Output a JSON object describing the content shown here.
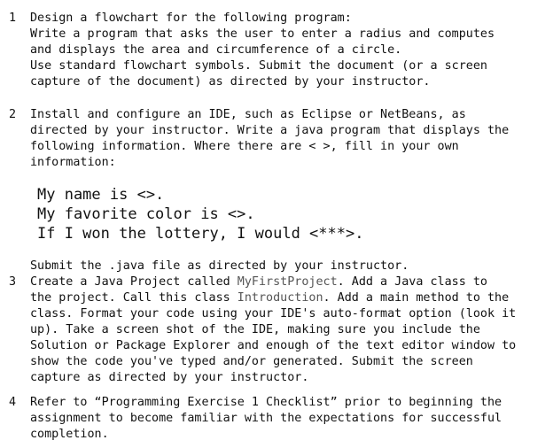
{
  "items": [
    {
      "number": "1",
      "lines": [
        "Design a flowchart for the following program:",
        "Write a program that asks the user to enter a radius and computes",
        "and displays the area and circumference of a circle.",
        "Use standard flowchart symbols. Submit the document (or a screen",
        "capture of the document) as directed by your instructor."
      ]
    },
    {
      "number": "2",
      "lines": [
        "Install and configure an IDE, such as Eclipse or NetBeans, as",
        "directed by your instructor. Write a java program that displays the",
        "following information. Where there are < >, fill in your own",
        "information:"
      ],
      "example_lines": [
        "My name is <>.",
        "My favorite color is <>.",
        "If I won the lottery, I would <***>."
      ],
      "after": "Submit the .java file as directed by your instructor."
    },
    {
      "number": "3",
      "line1_before": "Create a Java Project called ",
      "project_name": "MyFirstProject",
      "line1_after": ". Add a Java class to",
      "line2_before": "the project. Call this class ",
      "class_name": "Introduction",
      "line2_after": ". Add a main method to the",
      "lines": [
        "class. Format your code using your IDE's auto-format option (look it",
        "up). Take a screen shot of the IDE, making sure you include the",
        "Solution or Package Explorer and enough of the text editor window to",
        "show the code you've typed and/or generated. Submit the screen",
        "capture as directed by your instructor."
      ]
    },
    {
      "number": "4",
      "lines": [
        "Refer to “Programming Exercise 1 Checklist” prior to beginning the",
        "assignment to become familiar with the expectations for successful",
        "completion."
      ]
    }
  ]
}
